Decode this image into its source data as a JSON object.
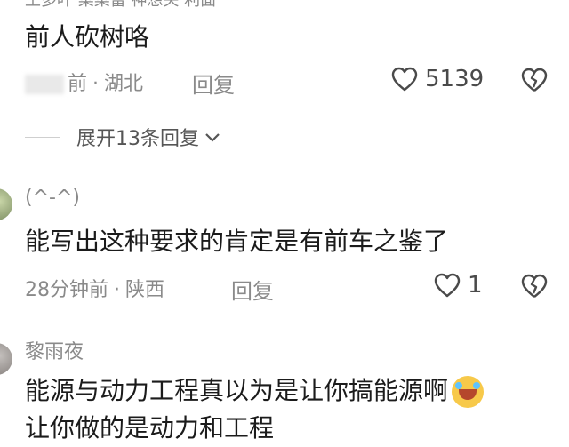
{
  "top_cutoff_text": "王多叶 菜菜雷 神想关 利面",
  "comments": [
    {
      "text": "前人砍树咯",
      "meta_time_suffix": "前",
      "meta_location": "湖北",
      "reply_label": "回复",
      "like_count": "5139",
      "expand_label": "展开13条回复"
    },
    {
      "username": "(^-^)",
      "text": "能写出这种要求的肯定是有前车之鉴了",
      "meta_time": "28分钟前",
      "meta_location": "陕西",
      "reply_label": "回复",
      "like_count": "1"
    },
    {
      "username": "黎雨夜",
      "text_line1": "能源与动力工程真以为是让你搞能源啊",
      "text_line2": "让你做的是动力和工程",
      "emoji_icon": "rolling-laughing-emoji"
    }
  ],
  "separator": "·"
}
